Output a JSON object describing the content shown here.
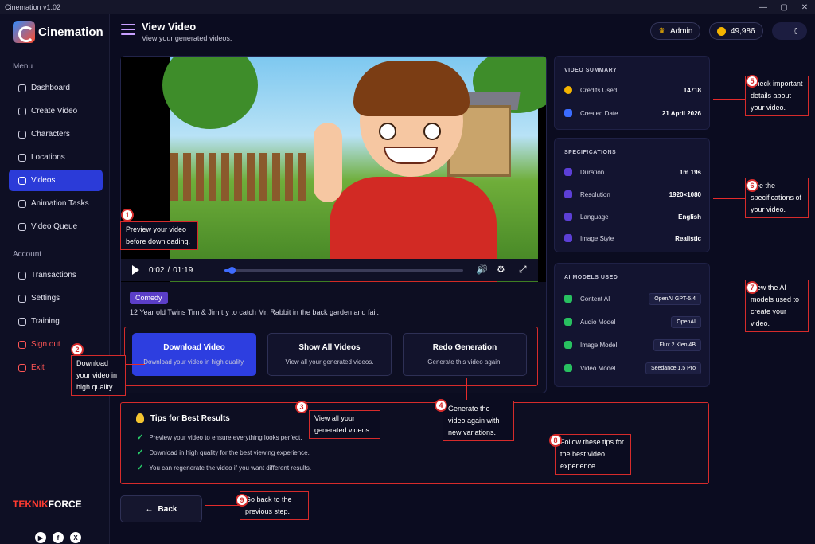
{
  "window": {
    "title": "Cinemation v1.02",
    "controls": [
      "—",
      "▢",
      "✕"
    ]
  },
  "brand": {
    "name": "Cinemation",
    "footer_part1": "TEKNIK",
    "footer_part2": "FORCE"
  },
  "sidebar": {
    "menu_label": "Menu",
    "account_label": "Account",
    "items": [
      {
        "label": "Dashboard",
        "icon": "dashboard-icon"
      },
      {
        "label": "Create Video",
        "icon": "plus-icon"
      },
      {
        "label": "Characters",
        "icon": "user-icon"
      },
      {
        "label": "Locations",
        "icon": "location-icon"
      },
      {
        "label": "Videos",
        "icon": "video-icon",
        "active": true
      },
      {
        "label": "Animation Tasks",
        "icon": "list-icon"
      },
      {
        "label": "Video Queue",
        "icon": "queue-icon"
      }
    ],
    "account_items": [
      {
        "label": "Transactions",
        "icon": "refresh-icon"
      },
      {
        "label": "Settings",
        "icon": "gear-icon"
      },
      {
        "label": "Training",
        "icon": "book-icon"
      },
      {
        "label": "Sign out",
        "icon": "signout-icon"
      },
      {
        "label": "Exit",
        "icon": "exit-icon"
      }
    ],
    "socials": [
      "youtube-icon",
      "facebook-icon",
      "x-icon"
    ]
  },
  "header": {
    "title": "View Video",
    "subtitle": "View your generated videos.",
    "user": "Admin",
    "credits": "49,986",
    "theme_icon": "moon-icon"
  },
  "player": {
    "time_current": "0:02",
    "time_total": "01:19",
    "progress": 0.03
  },
  "video": {
    "tag": "Comedy",
    "description": "12 Year old Twins Tim & Jim try to catch Mr. Rabbit in the back garden and fail."
  },
  "actions": [
    {
      "label": "Download Video",
      "sub": "Download your video in high quality."
    },
    {
      "label": "Show All Videos",
      "sub": "View all your generated videos."
    },
    {
      "label": "Redo Generation",
      "sub": "Generate this video again."
    }
  ],
  "summary": {
    "title": "VIDEO SUMMARY",
    "rows": [
      {
        "label": "Credits Used",
        "value": "14718"
      },
      {
        "label": "Created Date",
        "value": "21 April 2026"
      }
    ]
  },
  "specs": {
    "title": "SPECIFICATIONS",
    "rows": [
      {
        "label": "Duration",
        "value": "1m 19s"
      },
      {
        "label": "Resolution",
        "value": "1920×1080"
      },
      {
        "label": "Language",
        "value": "English"
      },
      {
        "label": "Image Style",
        "value": "Realistic"
      }
    ]
  },
  "models": {
    "title": "AI MODELS USED",
    "rows": [
      {
        "label": "Content AI",
        "value": "OpenAI GPT-5.4"
      },
      {
        "label": "Audio Model",
        "value": "OpenAI"
      },
      {
        "label": "Image Model",
        "value": "Flux 2 Klen 4B"
      },
      {
        "label": "Video Model",
        "value": "Seedance 1.5 Pro"
      }
    ]
  },
  "tips": {
    "title": "Tips for Best Results",
    "items": [
      "Preview your video to ensure everything looks perfect.",
      "Download in high quality for the best viewing experience.",
      "You can regenerate the video if you want different results."
    ]
  },
  "back": {
    "label": "Back"
  },
  "annotations": [
    {
      "num": "1",
      "text": "Preview your video before downloading."
    },
    {
      "num": "2",
      "text": "Download your video in high quality."
    },
    {
      "num": "3",
      "text": "View all your generated videos."
    },
    {
      "num": "4",
      "text": "Generate the video again with new variations."
    },
    {
      "num": "5",
      "text": "Check important details about your video."
    },
    {
      "num": "6",
      "text": "See the specifications of your video."
    },
    {
      "num": "7",
      "text": "View the AI models used to create your video."
    },
    {
      "num": "8",
      "text": "Follow these tips for the best video experience."
    },
    {
      "num": "9",
      "text": "Go back to the previous step."
    }
  ]
}
